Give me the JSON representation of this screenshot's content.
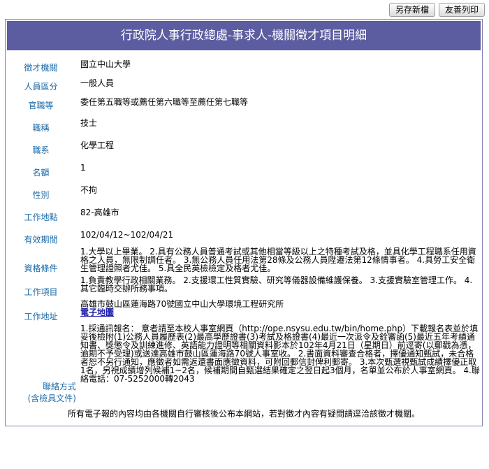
{
  "toolbar": {
    "save_label": "另存新檔",
    "print_label": "友善列印"
  },
  "title": "行政院人事行政總處-事求人-機關徵才項目明細",
  "fields": {
    "agency": {
      "label": "徵才機關",
      "value": "國立中山大學"
    },
    "category": {
      "label": "人員區分",
      "value": "一般人員"
    },
    "rank": {
      "label": "官職等",
      "value": "委任第五職等或薦任第六職等至薦任第七職等"
    },
    "title": {
      "label": "職稱",
      "value": "技士"
    },
    "series": {
      "label": "職系",
      "value": "化學工程"
    },
    "quota": {
      "label": "名額",
      "value": "1"
    },
    "gender": {
      "label": "性別",
      "value": "不拘"
    },
    "location": {
      "label": "工作地點",
      "value": "82-高雄市"
    },
    "period": {
      "label": "有效期間",
      "value": "102/04/12~102/04/21"
    },
    "requirements": {
      "label": "資格條件",
      "value": "1.大學以上畢業。 2.具有公務人員普通考試或其他相當等級以上之特種考試及格，並具化學工程職系任用資格之人員，無限制調任者。 3.無公務人員任用法第28條及公務人員陞遷法第12條情事者。 4.具勞工安全衛生管理證照者尤佳。 5.具全民英檢檢定及格者尤佳。"
    },
    "duties": {
      "label": "工作項目",
      "value": "1.負責教學行政相關業務。 2.支援環工性質實驗、研究等儀器設備維護保養。 3.支援實驗室管理工作。 4.其它臨時交辦所務事項。"
    },
    "address": {
      "label": "工作地址",
      "value": "高雄市鼓山區蓮海路70號國立中山大學環境工程研究所",
      "map_link": "電子地圖"
    },
    "contact": {
      "label": "聯絡方式",
      "label2": "(含檢具文件)",
      "value": "1.採通訊報名： 意者請至本校人事室網頁（http://ope.nsysu.edu.tw/bin/home.php）下載報名表並於填妥後檢附(1)公務人員履歷表(2)最高學歷證書(3)考試及格證書(4)最近一次派令及銓審函(5)最近五年考績通知書、獎懲令及訓練進修、英語能力證明等相關資料影本於102年4月21日（星期日）前逕寄(以郵戳為憑，逾期不予受理)或送達高雄市鼓山區蓮海路70號人事室收。 2.書面資料審查合格者，擇優通知甄試，未合格者恕不另行通知，應徵者如需返還書面應徵資料，可附回郵信封俾利郵寄。 3.本次甄選視甄試成績擇優正取1名，另視成績增列候補1~2名，候補期間自甄選結果確定之翌日起3個月，名單並公布於人事室網頁。 4.聯絡電話：07-5252000轉2043"
    }
  },
  "footer": "所有電子報的內容均由各機關自行審核後公布本網站，若對徵才內容有疑問請逕洽該徵才機關。",
  "colors": {
    "title_bg": "#5c5ca0",
    "label_text": "#1a6aa8",
    "link": "#1a1aa8"
  }
}
